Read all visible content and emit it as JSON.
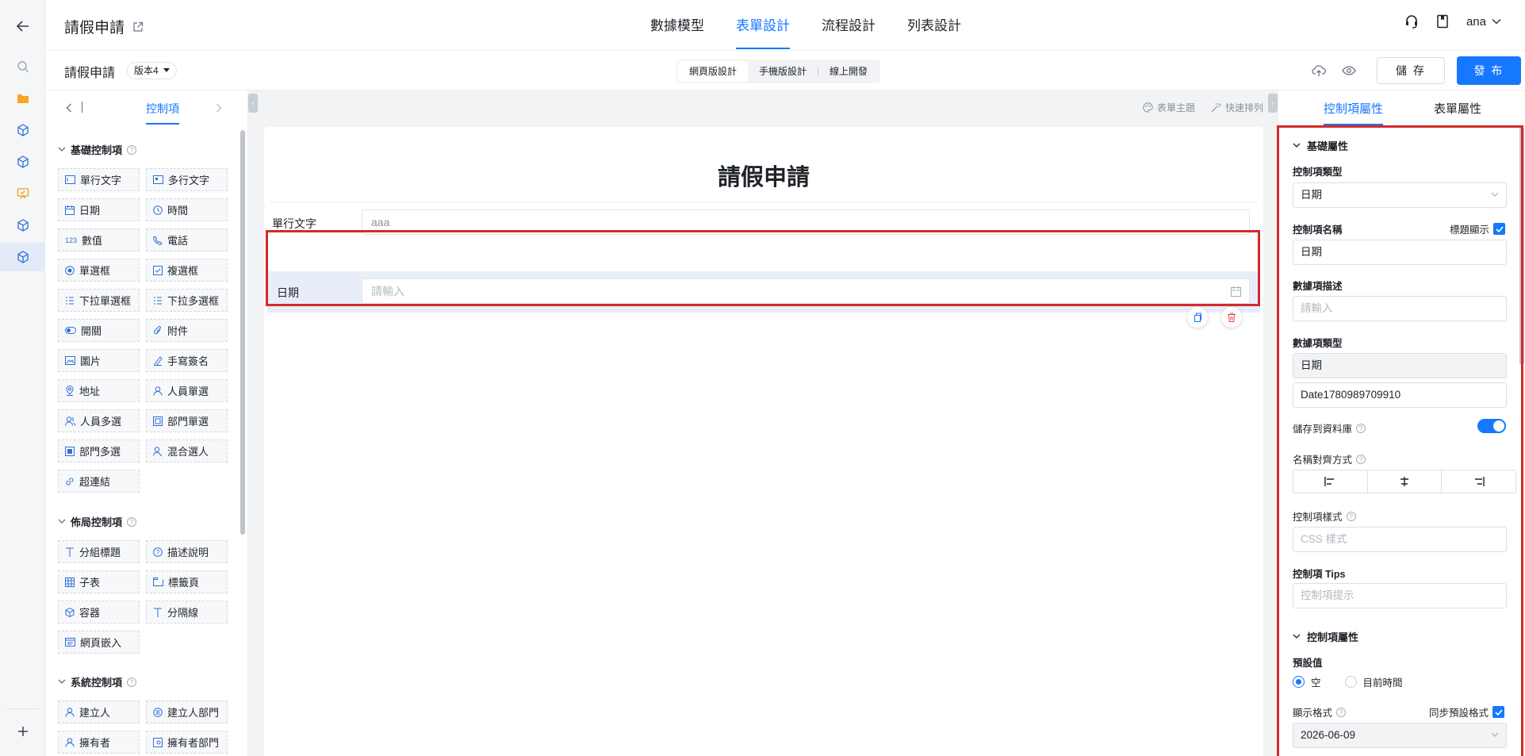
{
  "app": {
    "title": "請假申請",
    "tabs": [
      "數據模型",
      "表單設計",
      "流程設計",
      "列表設計"
    ],
    "active_tab": 1,
    "user": "ana"
  },
  "subbar": {
    "form_name": "請假申請",
    "version": "版本4",
    "views": [
      "網頁版設計",
      "手機版設計",
      "線上開發"
    ],
    "save_label": "儲 存",
    "publish_label": "發 布"
  },
  "palette": {
    "tab_label": "控制項",
    "basic_title": "基礎控制項",
    "basic_items": [
      "單行文字",
      "多行文字",
      "日期",
      "時間",
      "數值",
      "電話",
      "單選框",
      "複選框",
      "下拉單選框",
      "下拉多選框",
      "開關",
      "附件",
      "圖片",
      "手寫簽名",
      "地址",
      "人員單選",
      "人員多選",
      "部門單選",
      "部門多選",
      "混合選人",
      "超連結"
    ],
    "layout_title": "佈局控制項",
    "layout_items": [
      "分組標題",
      "描述說明",
      "子表",
      "標籤頁",
      "容器",
      "分隔線",
      "網頁嵌入"
    ],
    "system_title": "系統控制項",
    "system_items": [
      "建立人",
      "建立人部門",
      "擁有者",
      "擁有者部門"
    ]
  },
  "canvas": {
    "tool_theme": "表單主題",
    "tool_arrange": "快速排列",
    "form_title": "請假申請",
    "field1_label": "單行文字",
    "field1_value": "aaa",
    "field2_label": "日期",
    "field2_placeholder": "請輸入"
  },
  "props": {
    "tab_control": "控制項屬性",
    "tab_form": "表單屬性",
    "basic_section": "基礎屬性",
    "type_label": "控制項類型",
    "type_value": "日期",
    "name_label": "控制項名稱",
    "show_title_label": "標題顯示",
    "name_value": "日期",
    "desc_label": "數據項描述",
    "desc_placeholder": "請輸入",
    "data_type_label": "數據項類型",
    "data_type_value": "日期",
    "data_id_value": "Date1780989709910",
    "save_db_label": "儲存到資料庫",
    "align_label": "名稱對齊方式",
    "style_label": "控制項樣式",
    "style_placeholder": "CSS 樣式",
    "tips_label": "控制項 Tips",
    "tips_placeholder": "控制項提示",
    "control_section": "控制項屬性",
    "default_label": "預設值",
    "default_opt_empty": "空",
    "default_opt_now": "目前時間",
    "format_label": "顯示格式",
    "sync_format_label": "同步預設格式",
    "format_value": "2026-06-09"
  },
  "colors": {
    "accent": "#1677ff",
    "highlight_box": "#d42a2a",
    "selected_row": "#e8eef9"
  }
}
